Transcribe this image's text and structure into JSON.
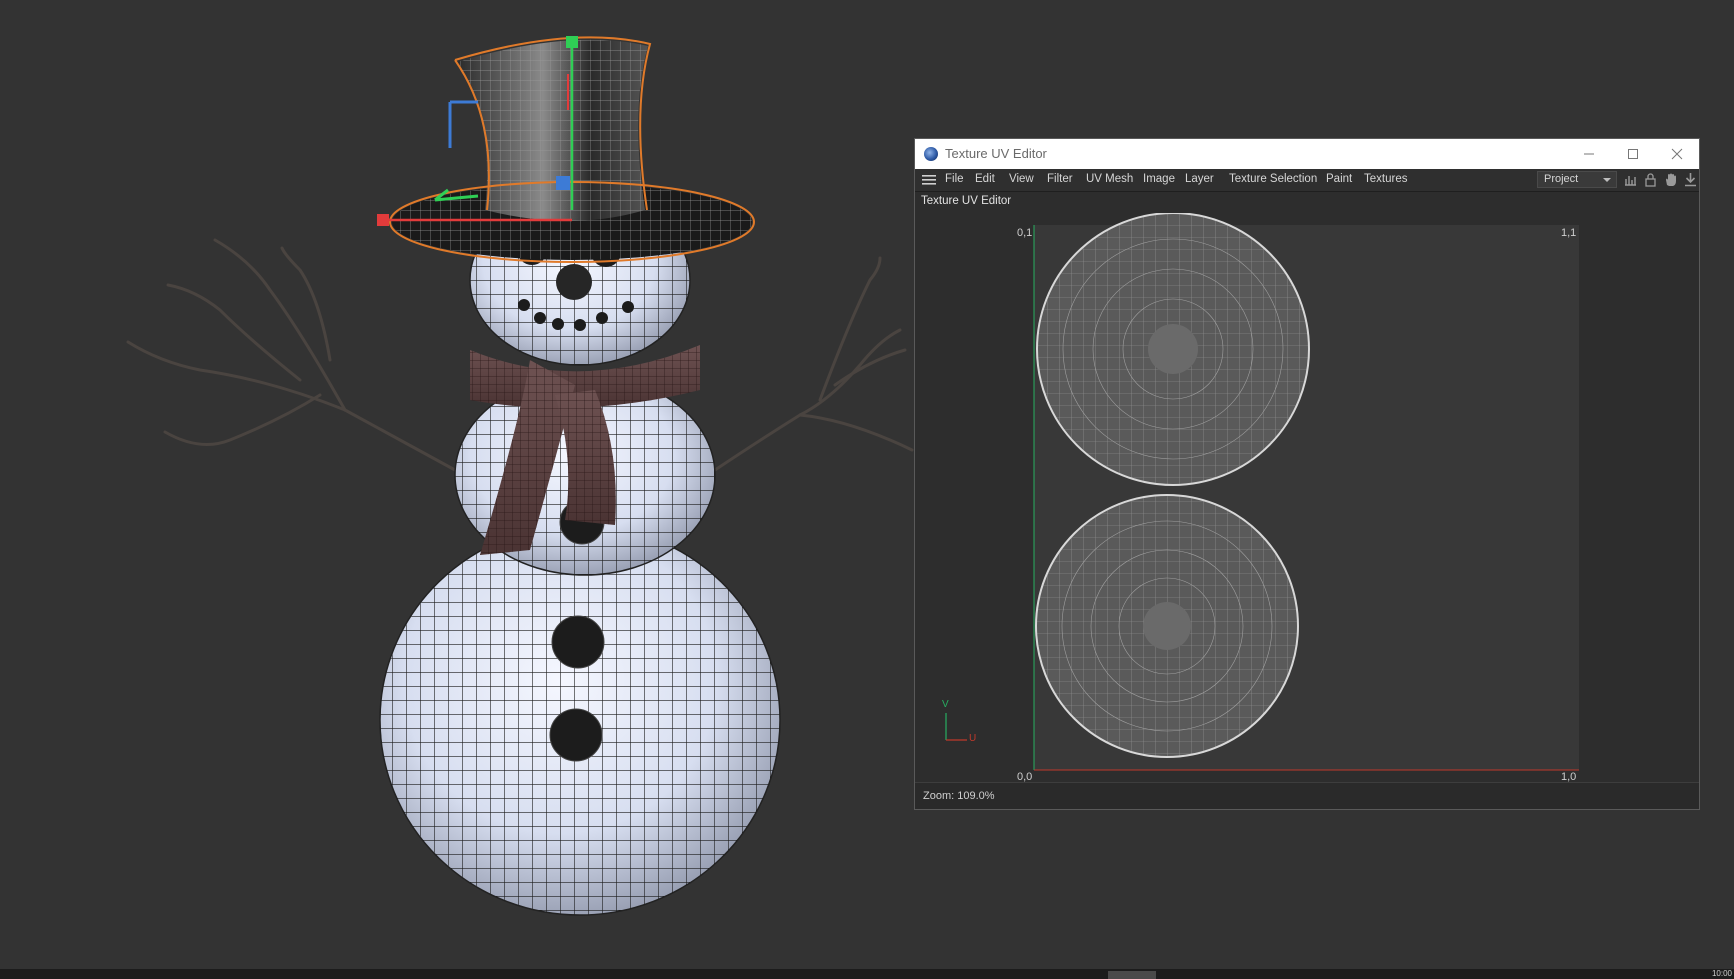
{
  "window": {
    "title": "Texture UV Editor",
    "panel_label": "Texture UV Editor",
    "controls": [
      "minimize-icon",
      "maximize-icon",
      "close-icon"
    ]
  },
  "menu": {
    "items": [
      "File",
      "Edit",
      "View",
      "Filter",
      "UV Mesh",
      "Image",
      "Layer",
      "Texture Selection",
      "Paint",
      "Textures"
    ],
    "project_select": "Project",
    "tool_icons": [
      "histogram-icon",
      "lock-icon",
      "hand-icon",
      "download-icon"
    ]
  },
  "uv_view": {
    "corner_top_left": "0,1",
    "corner_top_right": "1,1",
    "corner_bottom_left": "0,0",
    "corner_bottom_right": "1,0",
    "axis_v": "V",
    "axis_u": "U"
  },
  "status": {
    "zoom": "Zoom: 109.0%"
  },
  "taskbar": {
    "clock": "10:00"
  },
  "colors": {
    "background": "#333333",
    "selection_outline": "#e07a2a",
    "axis_x": "#e23b3b",
    "axis_y": "#2fcf55",
    "axis_z": "#3d7bd6",
    "uv_u_axis": "#c0392b",
    "uv_v_axis": "#27ae60"
  }
}
